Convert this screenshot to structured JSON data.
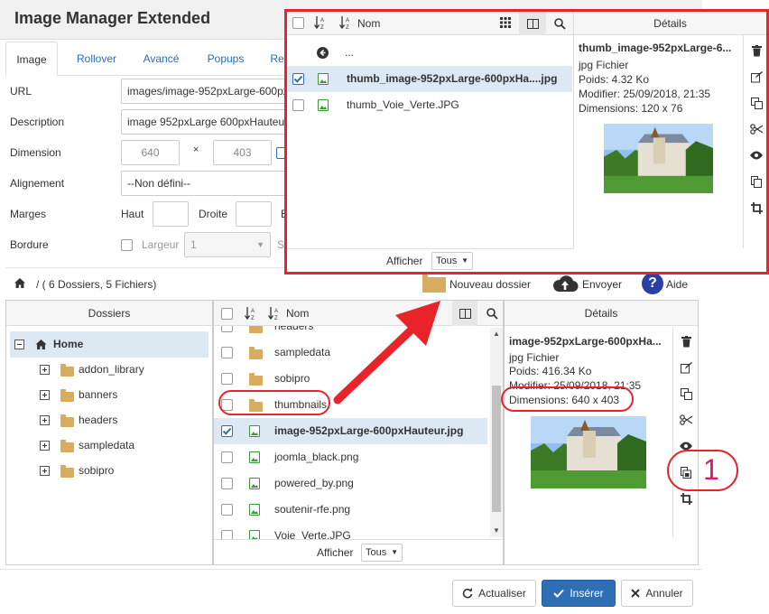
{
  "dialog": {
    "title": "Image Manager Extended",
    "tabs": [
      "Image",
      "Rollover",
      "Avancé",
      "Popups",
      "Re"
    ],
    "form": {
      "url_label": "URL",
      "url_value": "images/image-952pxLarge-600px",
      "description_label": "Description",
      "description_value": "image 952pxLarge 600pxHauteur",
      "dimension_label": "Dimension",
      "width": "640",
      "height": "403",
      "times": "×",
      "alignment_label": "Alignement",
      "alignment_value": "--Non défini--",
      "margins_label": "Marges",
      "margin_top": "Haut",
      "margin_right": "Droite",
      "margin_bottom_initial": "B",
      "border_label": "Bordure",
      "border_width_label": "Largeur",
      "border_width_value": "1",
      "border_style_initial": "S"
    }
  },
  "browser": {
    "path": "/ ( 6 Dossiers, 5 Fichiers)",
    "new_folder": "Nouveau dossier",
    "upload": "Envoyer",
    "help": "Aide",
    "folders_header": "Dossiers",
    "tree": {
      "root": "Home",
      "children": [
        "addon_library",
        "banners",
        "headers",
        "sampledata",
        "sobipro"
      ]
    },
    "list_header_name": "Nom",
    "files": [
      {
        "name": "headers",
        "kind": "folder"
      },
      {
        "name": "sampledata",
        "kind": "folder"
      },
      {
        "name": "sobipro",
        "kind": "folder"
      },
      {
        "name": "thumbnails",
        "kind": "folder"
      },
      {
        "name": "image-952pxLarge-600pxHauteur.jpg",
        "kind": "image",
        "selected": true
      },
      {
        "name": "joomla_black.png",
        "kind": "image"
      },
      {
        "name": "powered_by.png",
        "kind": "image"
      },
      {
        "name": "soutenir-rfe.png",
        "kind": "image"
      },
      {
        "name": "Voie_Verte.JPG",
        "kind": "image"
      }
    ],
    "show_label": "Afficher",
    "show_value": "Tous",
    "details": {
      "header": "Détails",
      "name": "image-952pxLarge-600pxHa...",
      "type": "jpg Fichier",
      "size": "Poids: 416.34 Ko",
      "modified": "Modifier: 25/09/2018, 21:35",
      "dimensions": "Dimensions: 640 x 403"
    }
  },
  "overlay": {
    "list_header_name": "Nom",
    "parent": "...",
    "files": [
      {
        "name": "thumb_image-952pxLarge-600pxHa....jpg",
        "selected": true
      },
      {
        "name": "thumb_Voie_Verte.JPG",
        "selected": false
      }
    ],
    "show_label": "Afficher",
    "show_value": "Tous",
    "details": {
      "header": "Détails",
      "name": "thumb_image-952pxLarge-6...",
      "type": "jpg Fichier",
      "size": "Poids: 4.32 Ko",
      "modified": "Modifier: 25/09/2018, 21:35",
      "dimensions": "Dimensions: 120 x 76"
    }
  },
  "annotation": {
    "number": "1"
  },
  "buttons": {
    "refresh": "Actualiser",
    "insert": "Insérer",
    "cancel": "Annuler"
  },
  "colors": {
    "accent": "#2d6fb5",
    "annotation_red": "#e8232a",
    "folder": "#d8ac5f",
    "image_icon": "#3a9a3a"
  }
}
